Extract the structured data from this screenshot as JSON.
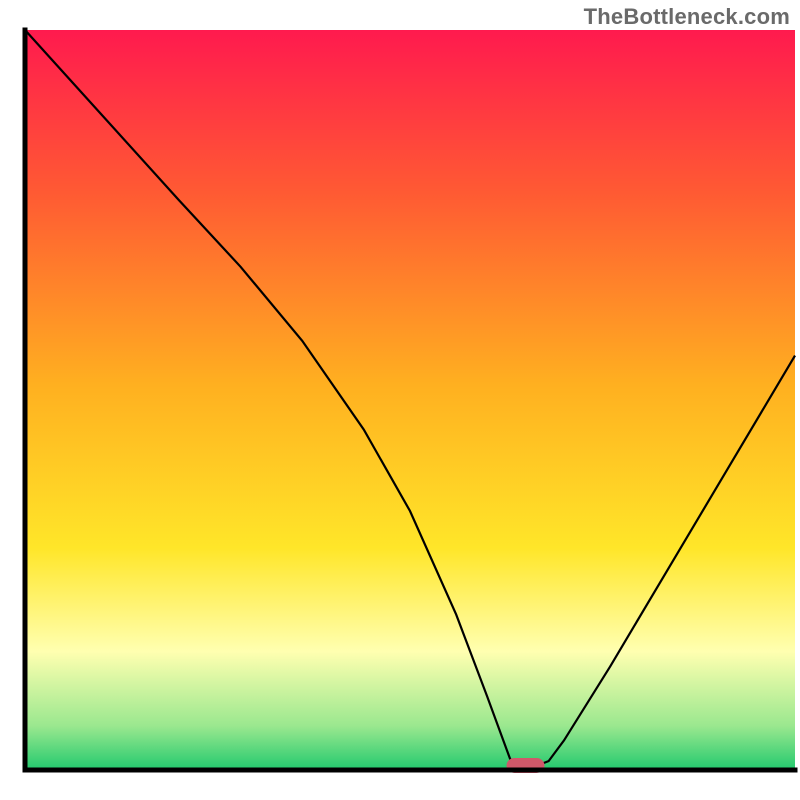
{
  "watermark": "TheBottleneck.com",
  "chart_data": {
    "type": "line",
    "title": "",
    "xlabel": "",
    "ylabel": "",
    "xlim": [
      0,
      100
    ],
    "ylim": [
      0,
      100
    ],
    "grid": false,
    "legend": false,
    "marker": {
      "x": 65,
      "y": 0,
      "color": "#d0596a"
    },
    "series": [
      {
        "name": "curve",
        "color": "#000000",
        "x": [
          0,
          10,
          20,
          28,
          36,
          44,
          50,
          56,
          60,
          63,
          65,
          68,
          70,
          76,
          84,
          92,
          100
        ],
        "values": [
          100,
          88.5,
          77,
          68,
          58,
          46,
          35,
          21,
          10,
          1.5,
          0,
          1.2,
          4,
          14,
          28,
          42,
          56
        ]
      }
    ],
    "background_gradient": {
      "top": "#ff1a4e",
      "upper": "#ff5a33",
      "mid": "#ffb020",
      "lower": "#ffe629",
      "pale": "#ffffb0",
      "green_top": "#9be88f",
      "green": "#22c96e"
    }
  }
}
